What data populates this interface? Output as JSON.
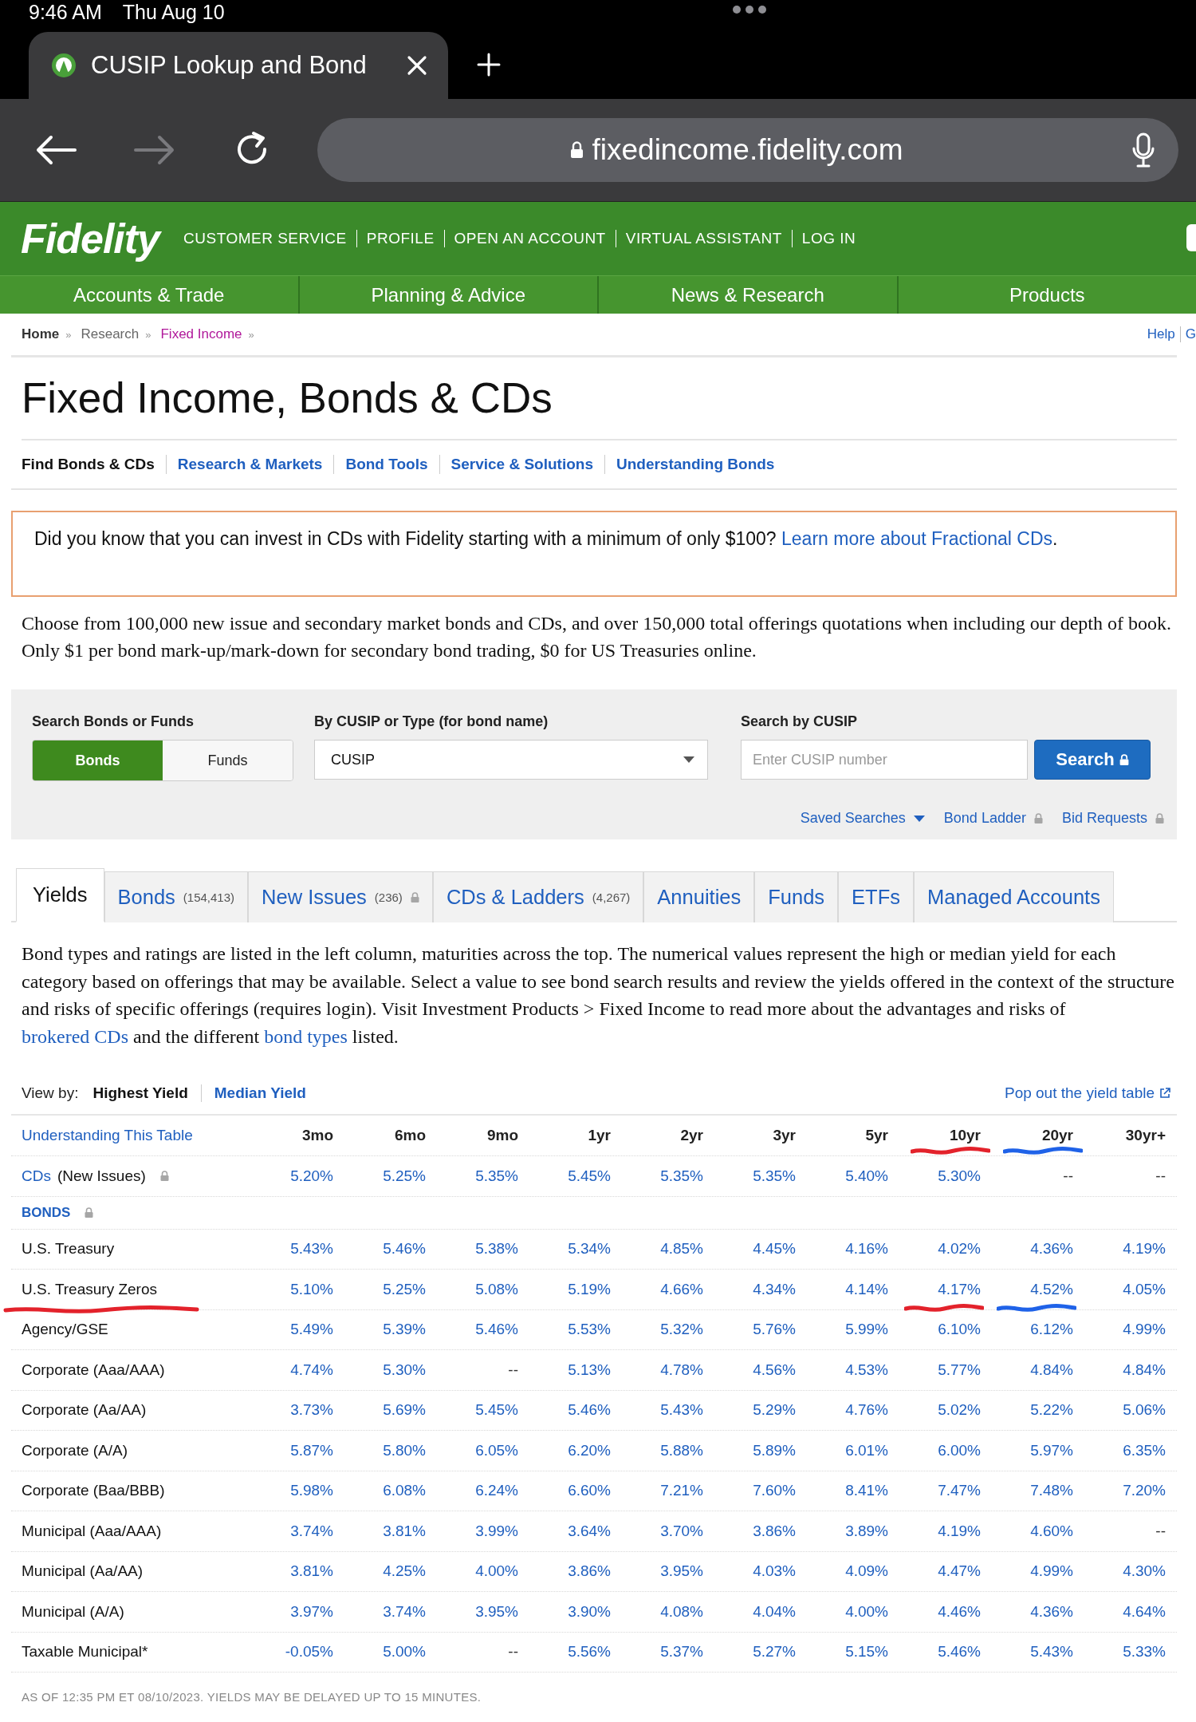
{
  "status_bar": {
    "time": "9:46 AM",
    "date": "Thu Aug 10"
  },
  "browser": {
    "tab_title": "CUSIP Lookup and Bond",
    "url": "fixedincome.fidelity.com"
  },
  "header": {
    "logo": "Fidelity",
    "links": [
      "CUSTOMER SERVICE",
      "PROFILE",
      "OPEN AN ACCOUNT",
      "VIRTUAL ASSISTANT",
      "LOG IN"
    ],
    "nav": [
      "Accounts & Trade",
      "Planning & Advice",
      "News & Research",
      "Products"
    ]
  },
  "breadcrumb": [
    {
      "label": "Home",
      "kind": "home",
      "separator": "»"
    },
    {
      "label": "Research",
      "kind": "plain",
      "separator": "»"
    },
    {
      "label": "Fixed Income",
      "kind": "current",
      "separator": "»"
    }
  ],
  "utility_links": [
    "Help",
    "G"
  ],
  "title": "Fixed Income, Bonds & CDs",
  "subnav": [
    {
      "label": "Find Bonds & CDs",
      "selected": true
    },
    {
      "label": "Research & Markets",
      "selected": false
    },
    {
      "label": "Bond Tools",
      "selected": false
    },
    {
      "label": "Service & Solutions",
      "selected": false
    },
    {
      "label": "Understanding Bonds",
      "selected": false
    }
  ],
  "banner": [
    {
      "kind": "text",
      "text": "Did you know that you can invest in CDs with Fidelity starting with a minimum of only $100? "
    },
    {
      "kind": "link",
      "text": "Learn more about Fractional CDs"
    },
    {
      "kind": "text",
      "text": "."
    }
  ],
  "intro": "Choose from 100,000 new issue and secondary market bonds and CDs, and over 150,000 total offerings quotations when including our depth of book. Only $1 per bond mark-up/mark-down for secondary bond trading, $0 for US Treasuries online.",
  "search": {
    "mode_label": "Search Bonds or Funds",
    "modes": [
      {
        "label": "Bonds",
        "selected": true
      },
      {
        "label": "Funds",
        "selected": false
      }
    ],
    "type_label": "By CUSIP or Type (for bond name)",
    "type_value": "CUSIP",
    "cusip_label": "Search by CUSIP",
    "cusip_field": {
      "placeholder": "Enter CUSIP number"
    },
    "button": "Search",
    "links": [
      {
        "label": "Saved Searches",
        "kind": "dropdown"
      },
      {
        "label": "Bond Ladder",
        "kind": "locked"
      },
      {
        "label": "Bid Requests",
        "kind": "locked"
      }
    ]
  },
  "tabs": [
    {
      "label": "Yields",
      "selected": true,
      "locked": false
    },
    {
      "label": "Bonds",
      "count": "(154,413)",
      "selected": false,
      "locked": false
    },
    {
      "label": "New Issues",
      "count": "(236)",
      "selected": false,
      "locked": true
    },
    {
      "label": "CDs & Ladders",
      "count": "(4,267)",
      "selected": false,
      "locked": false
    },
    {
      "label": "Annuities",
      "selected": false,
      "locked": false
    },
    {
      "label": "Funds",
      "selected": false,
      "locked": false
    },
    {
      "label": "ETFs",
      "selected": false,
      "locked": false
    },
    {
      "label": "Managed Accounts",
      "selected": false,
      "locked": false
    }
  ],
  "description": [
    {
      "kind": "text",
      "text": "Bond types and ratings are listed in the left column, maturities across the top. The numerical values represent the high or median yield for each category based on offerings that may be available. Select a value to see bond search results and review the yields offered in the context of the structure and risks of specific offerings (requires login). Visit Investment Products > Fixed Income to read more about the advantages and risks of "
    },
    {
      "kind": "link",
      "text": "brokered CDs"
    },
    {
      "kind": "text",
      "text": " and the different "
    },
    {
      "kind": "link",
      "text": "bond types"
    },
    {
      "kind": "text",
      "text": " listed."
    }
  ],
  "view_by": {
    "label": "View by:",
    "options": [
      {
        "label": "Highest Yield",
        "selected": true
      },
      {
        "label": "Median Yield",
        "selected": false
      }
    ],
    "popout": "Pop out the yield table"
  },
  "yield_table": {
    "corner_link": "Understanding This Table",
    "columns": [
      {
        "label": "3mo"
      },
      {
        "label": "6mo"
      },
      {
        "label": "9mo"
      },
      {
        "label": "1yr"
      },
      {
        "label": "2yr"
      },
      {
        "label": "3yr"
      },
      {
        "label": "5yr"
      },
      {
        "label": "10yr",
        "marker": {
          "color": "#e3222b"
        }
      },
      {
        "label": "20yr",
        "marker": {
          "color": "#1f62e8"
        }
      },
      {
        "label": "30yr+"
      }
    ],
    "rows": [
      {
        "kind": "cd",
        "link": "CDs",
        "label": "(New Issues)",
        "locked": true,
        "values": [
          "5.20%",
          "5.25%",
          "5.35%",
          "5.45%",
          "5.35%",
          "5.35%",
          "5.40%",
          "5.30%",
          "--",
          "--"
        ]
      },
      {
        "kind": "section",
        "label": "BONDS",
        "locked": true
      },
      {
        "kind": "bond",
        "label": "U.S. Treasury",
        "locked": false,
        "values": [
          "5.43%",
          "5.46%",
          "5.38%",
          "5.34%",
          "4.85%",
          "4.45%",
          "4.16%",
          "4.02%",
          "4.36%",
          "4.19%"
        ]
      },
      {
        "kind": "bond",
        "label": "U.S. Treasury Zeros",
        "locked": false,
        "marker": {
          "color": "#e3222b"
        },
        "values": [
          "5.10%",
          "5.25%",
          "5.08%",
          "5.19%",
          "4.66%",
          "4.34%",
          "4.14%",
          {
            "text": "4.17%",
            "marker": {
              "color": "#e3222b"
            }
          },
          {
            "text": "4.52%",
            "marker": {
              "color": "#1f62e8"
            }
          },
          "4.05%"
        ]
      },
      {
        "kind": "bond",
        "label": "Agency/GSE",
        "locked": false,
        "values": [
          "5.49%",
          "5.39%",
          "5.46%",
          "5.53%",
          "5.32%",
          "5.76%",
          "5.99%",
          "6.10%",
          "6.12%",
          "4.99%"
        ]
      },
      {
        "kind": "bond",
        "label": "Corporate (Aaa/AAA)",
        "locked": false,
        "values": [
          "4.74%",
          "5.30%",
          "--",
          "5.13%",
          "4.78%",
          "4.56%",
          "4.53%",
          "5.77%",
          "4.84%",
          "4.84%"
        ]
      },
      {
        "kind": "bond",
        "label": "Corporate (Aa/AA)",
        "locked": false,
        "values": [
          "3.73%",
          "5.69%",
          "5.45%",
          "5.46%",
          "5.43%",
          "5.29%",
          "4.76%",
          "5.02%",
          "5.22%",
          "5.06%"
        ]
      },
      {
        "kind": "bond",
        "label": "Corporate (A/A)",
        "locked": false,
        "values": [
          "5.87%",
          "5.80%",
          "6.05%",
          "6.20%",
          "5.88%",
          "5.89%",
          "6.01%",
          "6.00%",
          "5.97%",
          "6.35%"
        ]
      },
      {
        "kind": "bond",
        "label": "Corporate (Baa/BBB)",
        "locked": false,
        "values": [
          "5.98%",
          "6.08%",
          "6.24%",
          "6.60%",
          "7.21%",
          "7.60%",
          "8.41%",
          "7.47%",
          "7.48%",
          "7.20%"
        ]
      },
      {
        "kind": "bond",
        "label": "Municipal (Aaa/AAA)",
        "locked": false,
        "values": [
          "3.74%",
          "3.81%",
          "3.99%",
          "3.64%",
          "3.70%",
          "3.86%",
          "3.89%",
          "4.19%",
          "4.60%",
          "--"
        ]
      },
      {
        "kind": "bond",
        "label": "Municipal (Aa/AA)",
        "locked": false,
        "values": [
          "3.81%",
          "4.25%",
          "4.00%",
          "3.86%",
          "3.95%",
          "4.03%",
          "4.09%",
          "4.47%",
          "4.99%",
          "4.30%"
        ]
      },
      {
        "kind": "bond",
        "label": "Municipal (A/A)",
        "locked": false,
        "values": [
          "3.97%",
          "3.74%",
          "3.95%",
          "3.90%",
          "4.08%",
          "4.04%",
          "4.00%",
          "4.46%",
          "4.36%",
          "4.64%"
        ]
      },
      {
        "kind": "bond",
        "label": "Taxable Municipal*",
        "locked": false,
        "values": [
          "-0.05%",
          "5.00%",
          "--",
          "5.56%",
          "5.37%",
          "5.27%",
          "5.15%",
          "5.46%",
          "5.43%",
          "5.33%"
        ]
      }
    ]
  },
  "footnote": "AS OF 12:35 PM ET 08/10/2023. YIELDS MAY BE DELAYED UP TO 15 MINUTES."
}
